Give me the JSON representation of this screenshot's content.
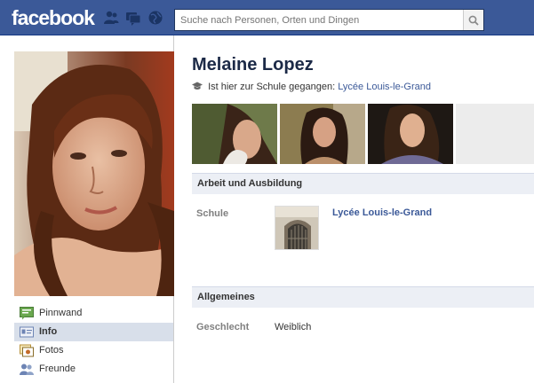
{
  "header": {
    "logo": "facebook",
    "search_placeholder": "Suche nach Personen, Orten und Dingen",
    "icons": [
      "friend-requests-icon",
      "messages-icon",
      "notifications-icon",
      "search-icon"
    ],
    "bar_color": "#3b5998"
  },
  "sidebar": {
    "items": [
      {
        "label": "Pinnwand",
        "icon": "wall-icon",
        "active": false
      },
      {
        "label": "Info",
        "icon": "info-icon",
        "active": true
      },
      {
        "label": "Fotos",
        "icon": "photos-icon",
        "active": false
      },
      {
        "label": "Freunde",
        "icon": "friends-icon",
        "active": false
      }
    ]
  },
  "profile": {
    "name": "Melaine Lopez",
    "education_prefix": "Ist hier zur Schule gegangen:",
    "education_school": "Lycée Louis-le-Grand"
  },
  "sections": {
    "work": {
      "title": "Arbeit und Ausbildung",
      "school_label": "Schule",
      "school_name": "Lycée Louis-le-Grand"
    },
    "general": {
      "title": "Allgemeines",
      "gender_label": "Geschlecht",
      "gender_value": "Weiblich"
    }
  },
  "colors": {
    "link": "#3b5998",
    "section_bg": "#eceff5",
    "active_nav_bg": "#d8dfea"
  }
}
